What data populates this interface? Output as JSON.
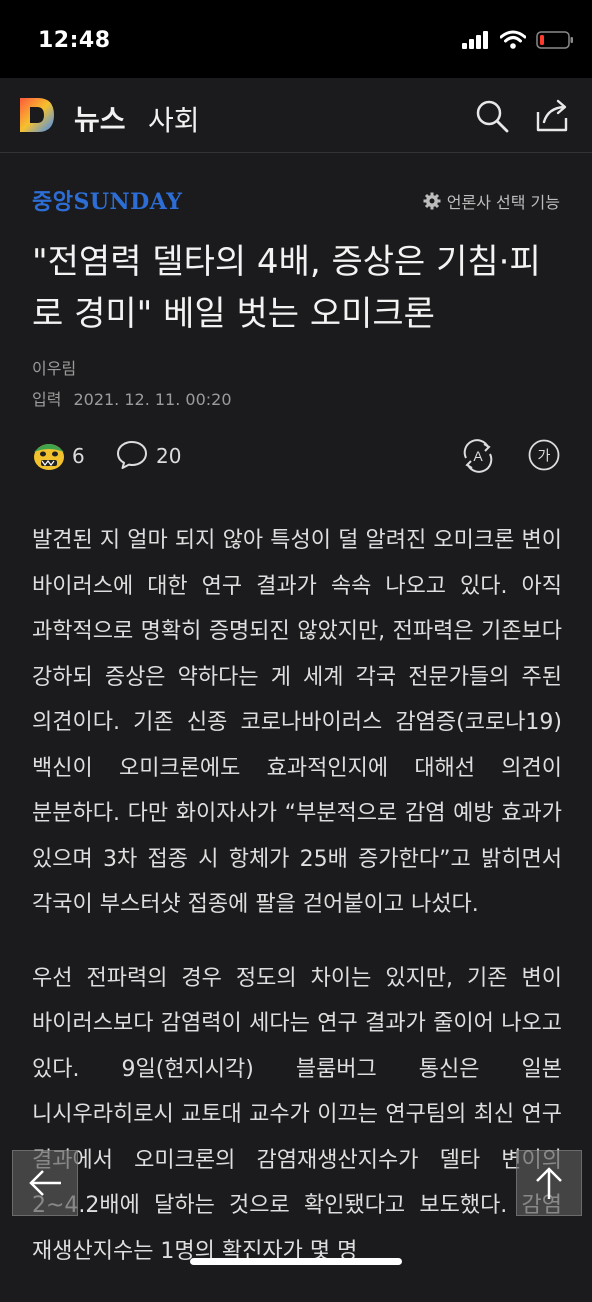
{
  "status": {
    "time": "12:48"
  },
  "appbar": {
    "news_label": "뉴스",
    "section_label": "사회"
  },
  "article": {
    "press_name": "중앙SUNDAY",
    "press_select_label": "언론사 선택 기능",
    "headline": "\"전염력 델타의 4배, 증상은 기침·피로 경미\" 베일 벗는 오미크론",
    "author": "이우림",
    "date_label": "입력",
    "date_value": "2021. 12. 11. 00:20",
    "like_count": "6",
    "comment_count": "20",
    "translate_icon_letter": "A",
    "font_icon_letter": "가",
    "paragraphs": [
      "발견된 지 얼마 되지 않아 특성이 덜 알려진 오미크론 변이 바이러스에 대한 연구 결과가 속속 나오고 있다. 아직 과학적으로 명확히 증명되진 않았지만, 전파력은 기존보다 강하되 증상은 약하다는 게 세계 각국 전문가들의 주된 의견이다. 기존 신종 코로나바이러스 감염증(코로나19) 백신이 오미크론에도 효과적인지에 대해선 의견이 분분하다. 다만 화이자사가 “부분적으로 감염 예방 효과가 있으며 3차 접종 시 항체가 25배 증가한다”고 밝히면서 각국이 부스터샷 접종에 팔을 걷어붙이고 나섰다.",
      "우선 전파력의 경우 정도의 차이는 있지만, 기존 변이 바이러스보다 감염력이 세다는 연구 결과가 줄이어 나오고 있다. 9일(현지시각) 블룸버그 통신은 일본 니시우라히로시 교토대 교수가 이끄는 연구팀의 최신 연구 결과에서 오미크론의 감염재생산지수가 델타 변이의 2~4.2배에 달하는 것으로 확인됐다고 보도했다. 감염 재생산지수는 1명의 확진자가 몇 명"
    ]
  },
  "colors": {
    "background": "#1b1b1d",
    "press_blue": "#2c6ed5"
  }
}
